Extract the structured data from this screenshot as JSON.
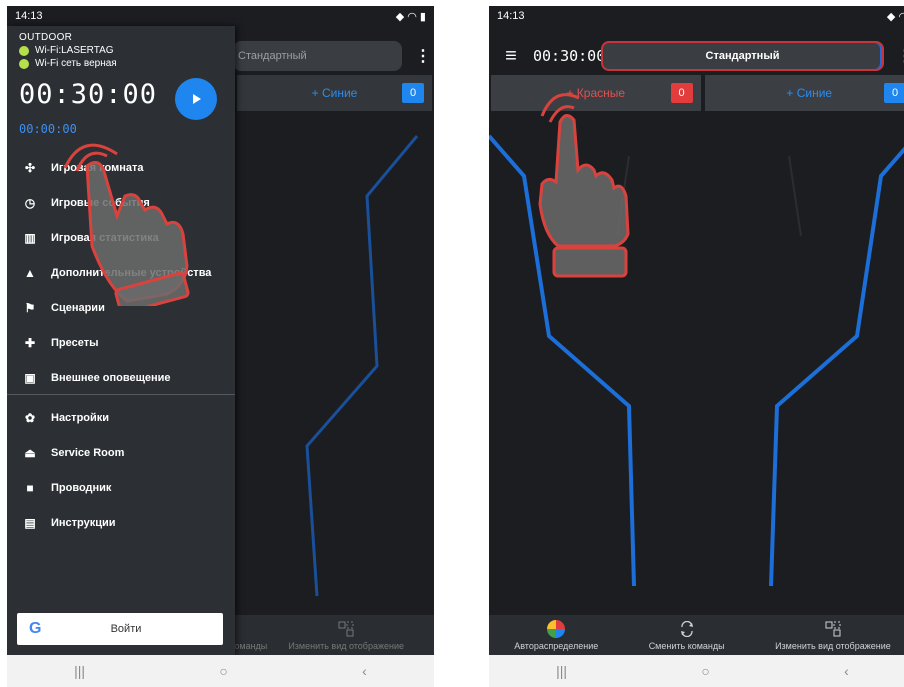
{
  "left_screen": {
    "status": {
      "time": "14:13"
    },
    "topbar": {
      "mode": "Стандартный"
    },
    "teams": {
      "blue_label": "+ Синие",
      "blue_score": "0"
    },
    "toolbar": {
      "change_label": "Сменить команды",
      "view_label": "Изменить вид отображение"
    },
    "drawer": {
      "location": "OUTDOOR",
      "wifi_name": "Wi-Fi:LASERTAG",
      "wifi_status": "Wi-Fi сеть верная",
      "game_timer": "00:30:00",
      "elapsed_timer": "00:00:00",
      "menu_items": [
        {
          "label": "Игровая комната",
          "icon": "gamepad-icon"
        },
        {
          "label": "Игровые события",
          "icon": "timer-icon"
        },
        {
          "label": "Игровая статистика",
          "icon": "stats-icon"
        },
        {
          "label": "Дополнительные устройства",
          "icon": "devices-icon"
        },
        {
          "label": "Сценарии",
          "icon": "flag-icon"
        },
        {
          "label": "Пресеты",
          "icon": "puzzle-icon"
        },
        {
          "label": "Внешнее оповещение",
          "icon": "notification-icon"
        }
      ],
      "settings_items": [
        {
          "label": "Настройки",
          "icon": "gear-icon"
        },
        {
          "label": "Service Room",
          "icon": "cloche-icon"
        },
        {
          "label": "Проводник",
          "icon": "folder-icon"
        },
        {
          "label": "Инструкции",
          "icon": "book-icon"
        }
      ],
      "login_label": "Войти",
      "login_logo": "G"
    }
  },
  "right_screen": {
    "status": {
      "time": "14:13"
    },
    "topbar": {
      "timer": "00:30:00",
      "mode": "Стандартный"
    },
    "teams": {
      "red_label": "+ Красные",
      "red_score": "0",
      "blue_label": "+ Синие",
      "blue_score": "0"
    },
    "toolbar": {
      "auto_label": "Автораспределение",
      "change_label": "Сменить команды",
      "view_label": "Изменить вид отображение"
    }
  },
  "colors": {
    "accent_blue": "#1f86f0",
    "accent_red": "#e23c3c",
    "wifi_ok": "#b6e04a"
  }
}
